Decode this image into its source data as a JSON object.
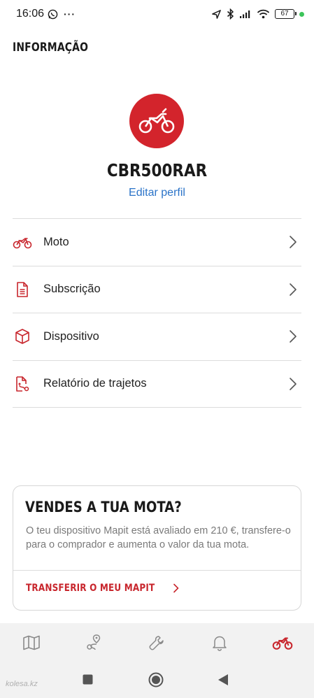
{
  "status_bar": {
    "time": "16:06",
    "battery": "67",
    "more": "···"
  },
  "header": {
    "title": "INFORMAÇÃO"
  },
  "profile": {
    "name": "CBR500RAR",
    "edit_label": "Editar perfil"
  },
  "menu": {
    "items": [
      {
        "label": "Moto",
        "icon": "motorcycle-icon"
      },
      {
        "label": "Subscrição",
        "icon": "document-icon"
      },
      {
        "label": "Dispositivo",
        "icon": "box-icon"
      },
      {
        "label": "Relatório de trajetos",
        "icon": "route-report-icon"
      }
    ]
  },
  "promo": {
    "title": "VENDES A TUA MOTA?",
    "text": "O teu dispositivo Mapit está avaliado em 210 €, transfere-o para o comprador e aumenta o valor da tua mota.",
    "action_label": "TRANSFERIR O MEU MAPIT"
  },
  "bottom_nav": {
    "items": [
      {
        "icon": "map-icon",
        "active": false
      },
      {
        "icon": "route-icon",
        "active": false
      },
      {
        "icon": "wrench-icon",
        "active": false
      },
      {
        "icon": "bell-icon",
        "active": false
      },
      {
        "icon": "motorcycle-icon",
        "active": true
      }
    ]
  },
  "watermark": {
    "text": "kolesa.kz"
  },
  "colors": {
    "accent": "#d3242c",
    "link": "#2a73c8",
    "text_muted": "#7a7a7a",
    "divider": "#dcdcdc"
  }
}
